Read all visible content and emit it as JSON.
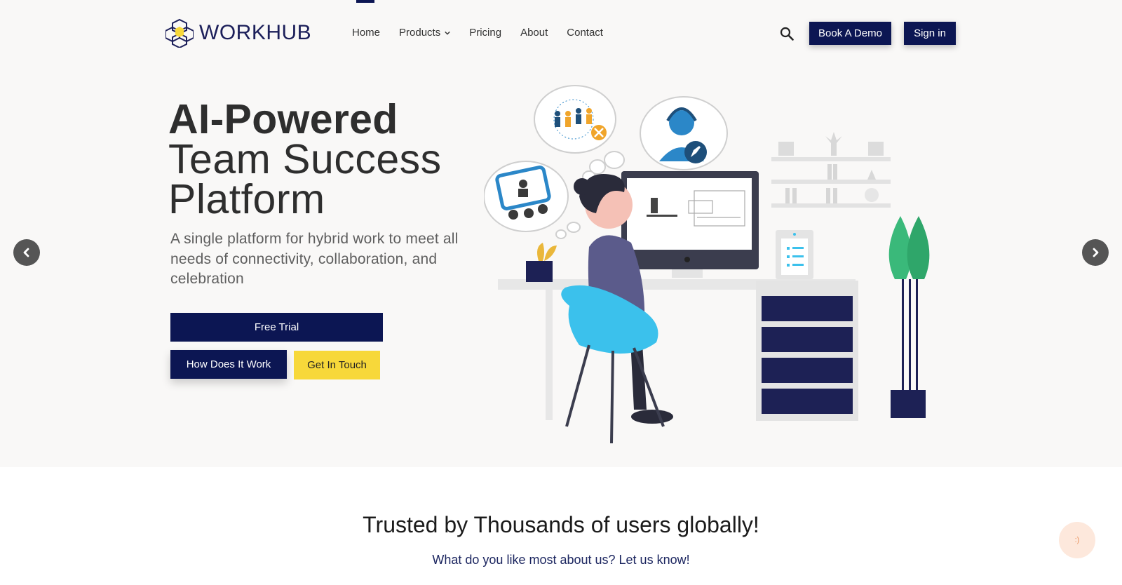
{
  "brand": {
    "name": "WORKHUB",
    "navy": "#0c1653",
    "yellow": "#f7d83a"
  },
  "nav": {
    "items": [
      {
        "label": "Home"
      },
      {
        "label": "Products",
        "has_dropdown": true
      },
      {
        "label": "Pricing"
      },
      {
        "label": "About"
      },
      {
        "label": "Contact"
      }
    ],
    "search_icon": "search-icon",
    "book_demo": "Book A Demo",
    "sign_in": "Sign in"
  },
  "hero": {
    "title_bold": "AI-Powered",
    "title_line2": "Team Success",
    "title_line3": "Platform",
    "subtitle": "A single platform for hybrid work to meet all needs of connectivity, collaboration, and celebration",
    "free_trial": "Free Trial",
    "how_it_works": "How Does It Work",
    "get_in_touch": "Get In Touch",
    "prev_icon": "chevron-left-icon",
    "next_icon": "chevron-right-icon"
  },
  "trusted": {
    "heading": "Trusted by Thousands of users globally!",
    "prompt": "What do you like most about us? Let us know!"
  },
  "chat": {
    "label": ":)"
  }
}
